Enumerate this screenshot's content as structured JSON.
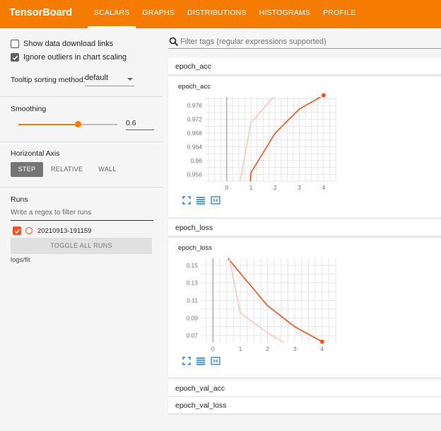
{
  "app": {
    "title": "TensorBoard"
  },
  "nav": {
    "tabs": [
      "SCALARS",
      "GRAPHS",
      "DISTRIBUTIONS",
      "HISTOGRAMS",
      "PROFILE"
    ],
    "active": "SCALARS"
  },
  "sidebar": {
    "show_data_download": {
      "label": "Show data download links",
      "checked": false
    },
    "ignore_outliers": {
      "label": "Ignore outliers in chart scaling",
      "checked": true
    },
    "tooltip_sorting": {
      "label": "Tooltip sorting method:",
      "value": "default"
    },
    "smoothing": {
      "label": "Smoothing",
      "value": "0.6",
      "fraction": 0.6
    },
    "horizontal_axis": {
      "label": "Horizontal Axis",
      "options": [
        "STEP",
        "RELATIVE",
        "WALL"
      ],
      "selected": "STEP"
    },
    "runs": {
      "label": "Runs",
      "filter_placeholder": "Write a regex to filter runs",
      "items": [
        {
          "name": "20210913-191159",
          "checked": true
        }
      ],
      "toggle_label": "TOGGLE ALL RUNS",
      "logdir": "logs/fit"
    }
  },
  "main": {
    "filter_placeholder": "Filter tags (regular expressions supported)",
    "groups": [
      "epoch_acc",
      "epoch_loss",
      "epoch_val_acc",
      "epoch_val_loss"
    ]
  },
  "colors": {
    "accent": "#f57c00",
    "run": "#f4511e",
    "run_raw": "#fbbfae"
  },
  "icons": [
    "search-icon",
    "fullscreen-icon",
    "data-icon",
    "fit-domain-icon",
    "check-icon",
    "dropdown-arrow-icon"
  ],
  "chart_data": [
    {
      "type": "line",
      "title": "epoch_acc",
      "x_ticks": [
        0,
        1,
        2,
        3,
        4
      ],
      "y_ticks": [
        0.956,
        0.96,
        0.964,
        0.968,
        0.972,
        0.976
      ],
      "xlim": [
        -0.9,
        4.5
      ],
      "ylim": [
        0.954,
        0.9785
      ],
      "series": [
        {
          "style": "smoothed",
          "x": [
            0.97,
            1,
            2,
            3,
            4
          ],
          "y": [
            0.954,
            0.9565,
            0.968,
            0.975,
            0.979
          ]
        },
        {
          "style": "raw",
          "x": [
            0.55,
            1,
            2
          ],
          "y": [
            0.954,
            0.971,
            0.979
          ]
        }
      ]
    },
    {
      "type": "line",
      "title": "epoch_loss",
      "x_ticks": [
        0,
        1,
        2,
        3,
        4
      ],
      "y_ticks": [
        0.07,
        0.09,
        0.11,
        0.13,
        0.15
      ],
      "xlim": [
        -0.45,
        4.5
      ],
      "ylim": [
        0.062,
        0.158
      ],
      "series": [
        {
          "style": "smoothed",
          "x": [
            0.55,
            1,
            2,
            3,
            4
          ],
          "y": [
            0.158,
            0.141,
            0.104,
            0.08,
            0.063
          ]
        },
        {
          "style": "raw",
          "x": [
            0.6,
            1,
            2,
            2.6
          ],
          "y": [
            0.158,
            0.096,
            0.073,
            0.062
          ]
        }
      ]
    }
  ]
}
